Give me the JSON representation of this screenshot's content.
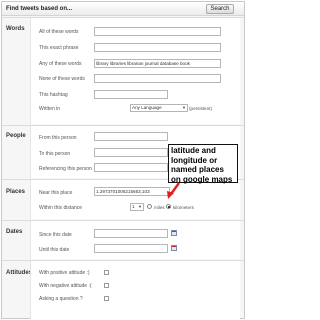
{
  "header": {
    "title": "Find tweets based on...",
    "search_label": "Search"
  },
  "words": {
    "section_label": "Words",
    "all_label": "All of these words",
    "all_value": "",
    "phrase_label": "This exact phrase",
    "phrase_value": "",
    "any_label": "Any of these words",
    "any_value": "library libraries librarian journal database book",
    "none_label": "None of these words",
    "none_value": "",
    "hashtag_label": "This hashtag",
    "hashtag_value": "",
    "written_in_label": "Written in",
    "language_value": "Any Language",
    "persistent_label": "(persistent)"
  },
  "people": {
    "section_label": "People",
    "from_label": "From this person",
    "from_value": "",
    "to_label": "To this person",
    "to_value": "",
    "referencing_label": "Referencing this person",
    "referencing_value": ""
  },
  "places": {
    "section_label": "Places",
    "near_label": "Near this place",
    "near_value": "1.2973701006215663,103",
    "within_label": "Within this distance",
    "distance_value": "1",
    "miles_label": "miles",
    "km_label": "kilometers",
    "unit_selected": "kilometers"
  },
  "dates": {
    "section_label": "Dates",
    "since_label": "Since this date",
    "since_value": "",
    "until_label": "Until this date",
    "until_value": ""
  },
  "attitudes": {
    "section_label": "Attitudes",
    "positive_label": "With positive attitude :)",
    "negative_label": "With negative attitude :(",
    "question_label": "Asking a question ?"
  },
  "annotation": {
    "text": "latitude and longitude or named places on google maps",
    "border_color": "#111111",
    "arrow_color": "#e02020"
  },
  "colors": {
    "panel_bg": "#f6f6f6",
    "body_bg": "#ffffff",
    "border": "#c9c9c9"
  }
}
